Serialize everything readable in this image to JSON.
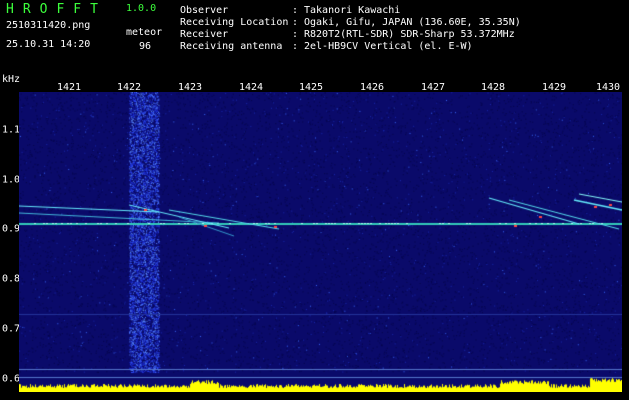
{
  "header": {
    "title": "HROFFT",
    "version": "1.0.0",
    "filename": "2510311420.png",
    "datetime": "25.10.31 14:20",
    "counter_label": "meteor",
    "counter_value": "96"
  },
  "meta": [
    {
      "key": "Observer",
      "value": "Takanori Kawachi"
    },
    {
      "key": "Receiving Location",
      "value": "Ogaki, Gifu, JAPAN (136.60E, 35.35N)"
    },
    {
      "key": "Receiver",
      "value": "R820T2(RTL-SDR) SDR-Sharp 53.372MHz"
    },
    {
      "key": "Receiving antenna",
      "value": "2el-HB9CV Vertical (el. E-W)"
    }
  ],
  "axis": {
    "unit": "kHz",
    "x_ticks": [
      "1421",
      "1422",
      "1423",
      "1424",
      "1425",
      "1426",
      "1427",
      "1428",
      "1429",
      "1430"
    ],
    "y_ticks": [
      "1.1",
      "1.0",
      "0.9",
      "0.8",
      "0.7",
      "0.6"
    ]
  },
  "colors": {
    "background": "#000000",
    "spectrum_bg": "#0a0a6a",
    "carrier": "#33ccbb",
    "trace": "#66eeff",
    "hot": "#ff4444",
    "amplitude": "#ffff00",
    "title": "#3cff3c"
  }
}
